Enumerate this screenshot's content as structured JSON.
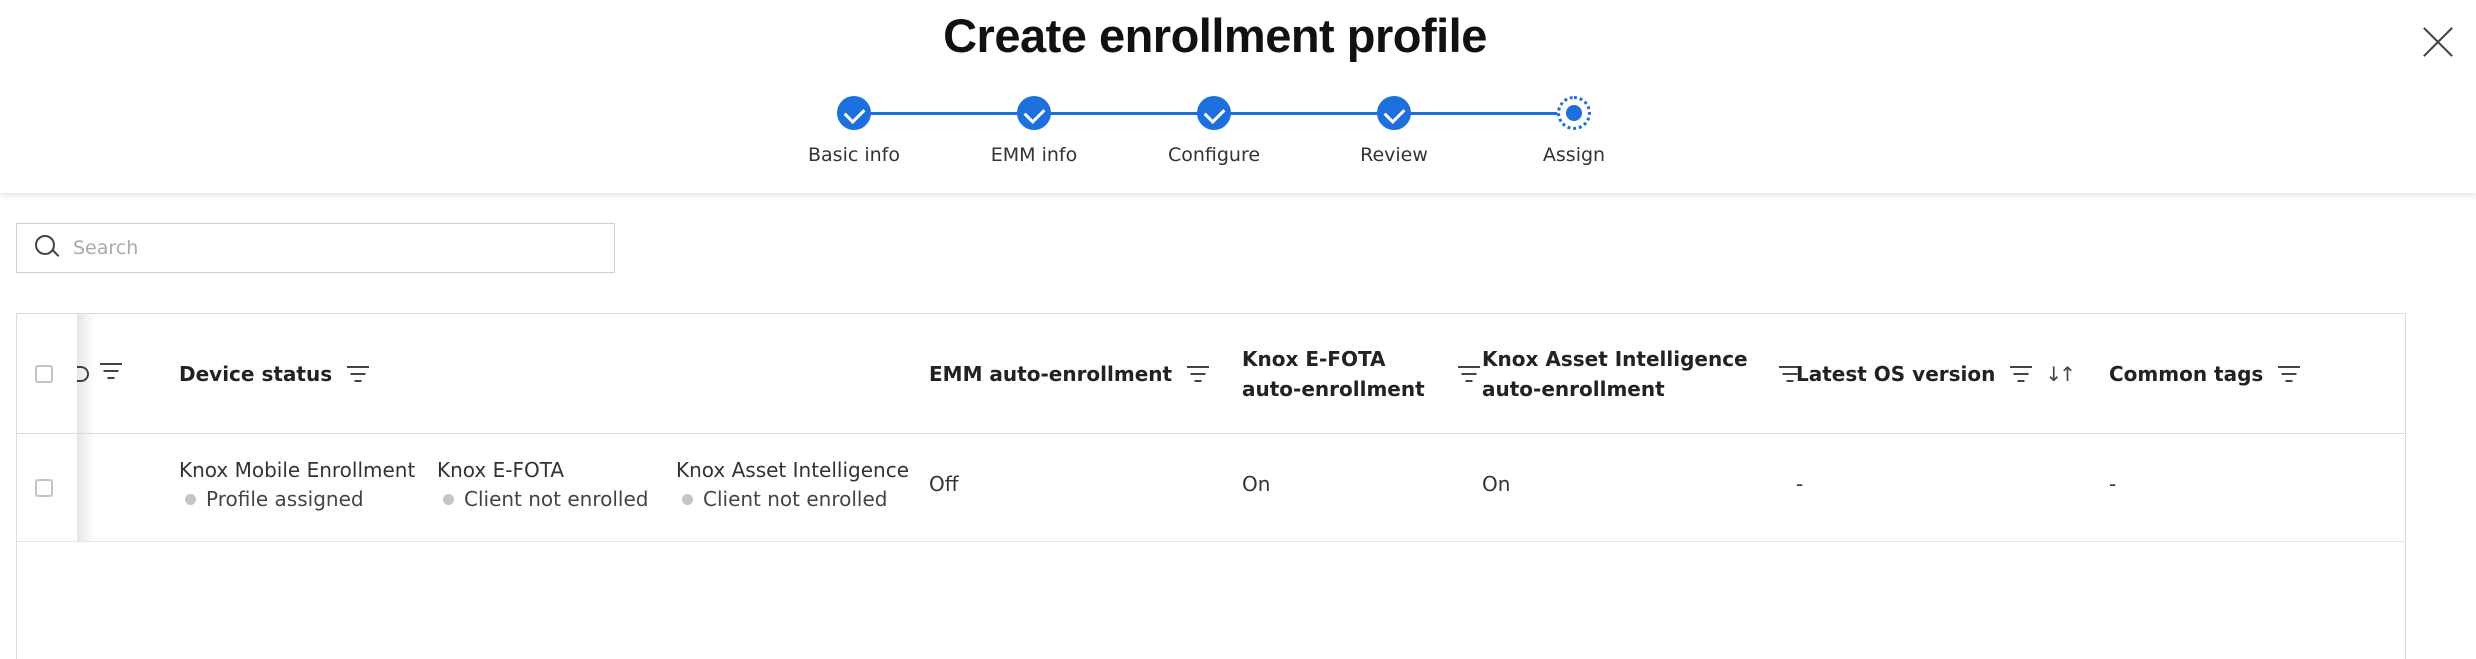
{
  "header": {
    "title": "Create enrollment profile",
    "steps": [
      {
        "label": "Basic info",
        "state": "complete"
      },
      {
        "label": "EMM info",
        "state": "complete"
      },
      {
        "label": "Configure",
        "state": "complete"
      },
      {
        "label": "Review",
        "state": "complete"
      },
      {
        "label": "Assign",
        "state": "current"
      }
    ]
  },
  "search": {
    "placeholder": "Search",
    "value": ""
  },
  "table": {
    "columns": {
      "device_status": "Device status",
      "emm": "EMM auto-enrollment",
      "efota_line1": "Knox E-FOTA",
      "efota_line2": "auto-enrollment",
      "kai_line1": "Knox Asset Intelligence",
      "kai_line2": "auto-enrollment",
      "latest_os": "Latest OS version",
      "tags": "Common tags"
    },
    "rows": [
      {
        "statuses": [
          {
            "name": "Knox Mobile Enrollment",
            "value": "Profile assigned"
          },
          {
            "name": "Knox E-FOTA",
            "value": "Client not enrolled"
          },
          {
            "name": "Knox Asset Intelligence",
            "value": "Client not enrolled"
          }
        ],
        "emm": "Off",
        "efota": "On",
        "kai": "On",
        "latest_os": "-",
        "tags": "-"
      }
    ]
  },
  "colors": {
    "accent": "#1c6fdc",
    "status_dot": "#c4c4c4"
  }
}
